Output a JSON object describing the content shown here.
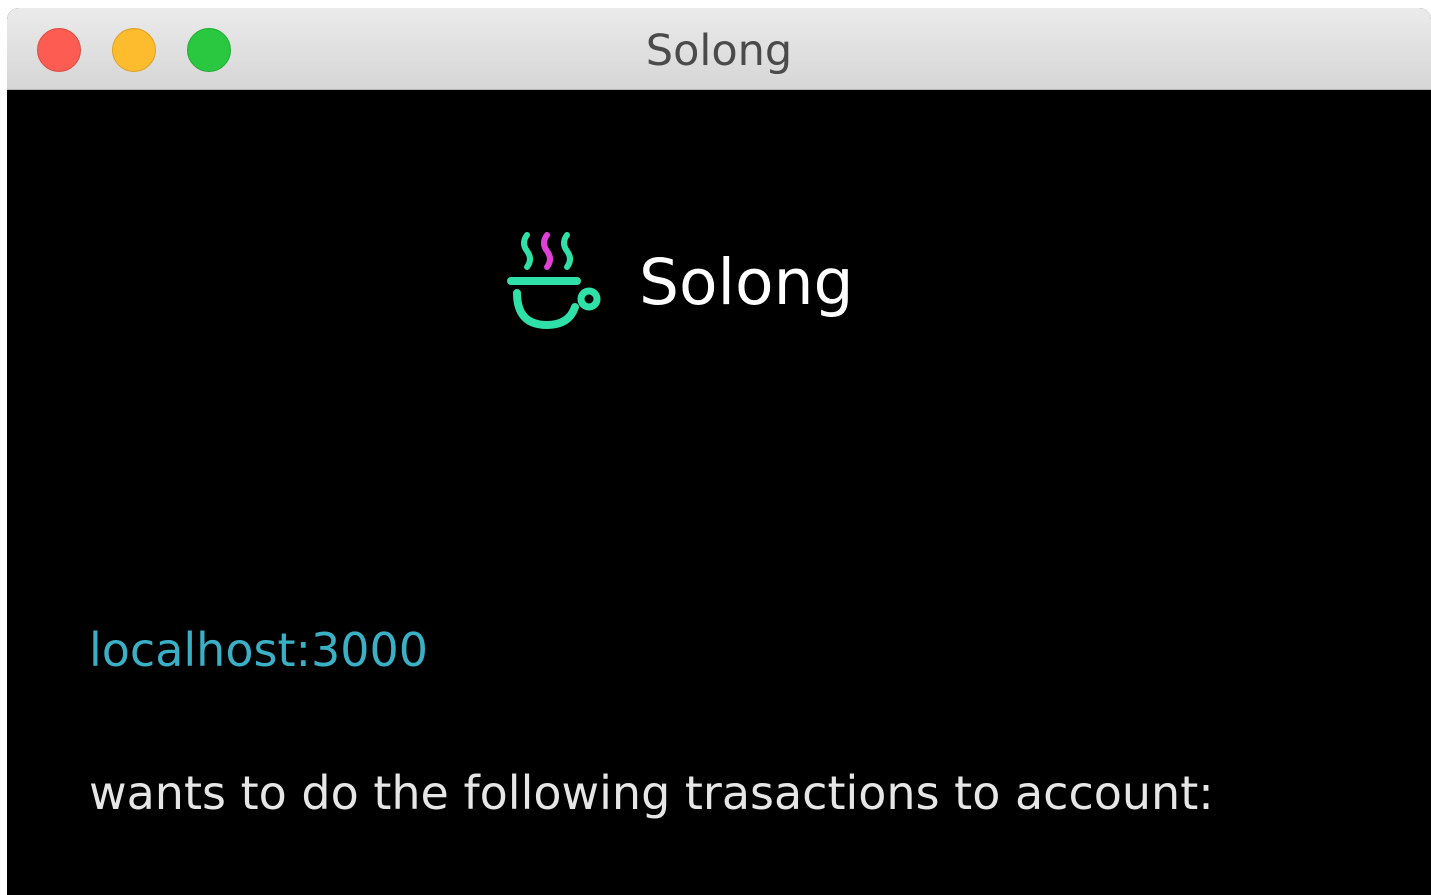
{
  "window": {
    "title": "Solong"
  },
  "brand": {
    "logo_icon": "coffee-cup-icon",
    "name": "Solong",
    "colors": {
      "cup": "#2fe0a8",
      "steam_accent": "#e040d8"
    }
  },
  "request": {
    "origin": "localhost:3000",
    "message": "wants to do the following trasactions to account:"
  },
  "colors": {
    "background": "#000000",
    "origin_text": "#3ab0c7",
    "message_text": "#e6e6e6"
  }
}
